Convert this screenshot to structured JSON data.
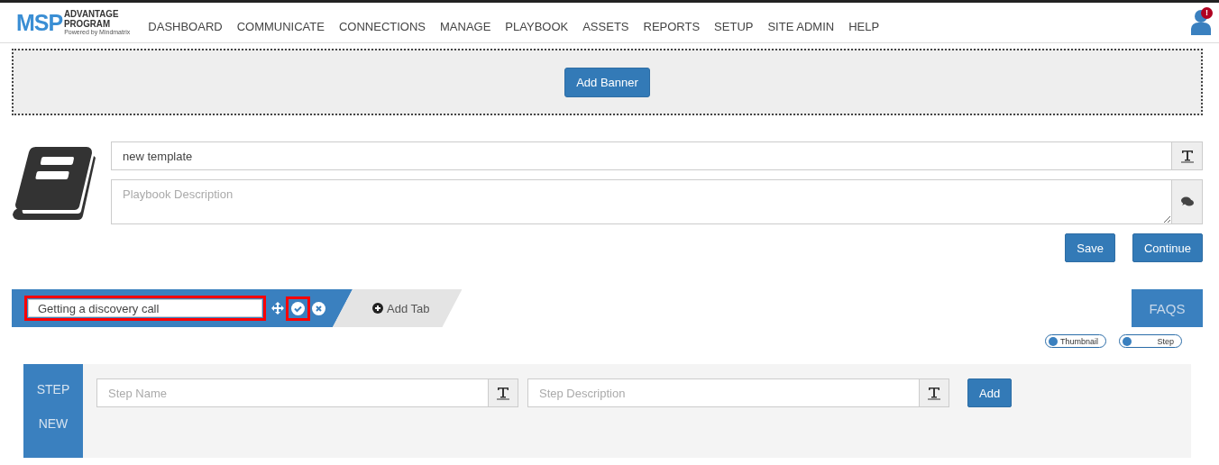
{
  "logo": {
    "main": "MSP",
    "line1": "ADVANTAGE",
    "line2": "PROGRAM",
    "tagline": "Powered by Mindmatrix"
  },
  "nav": [
    "DASHBOARD",
    "COMMUNICATE",
    "CONNECTIONS",
    "MANAGE",
    "PLAYBOOK",
    "ASSETS",
    "REPORTS",
    "SETUP",
    "SITE ADMIN",
    "HELP"
  ],
  "user": {
    "badge": "!"
  },
  "banner": {
    "button": "Add Banner"
  },
  "playbook": {
    "title_value": "new template",
    "description_placeholder": "Playbook Description",
    "buttons": [
      "Save",
      "Continue"
    ]
  },
  "tabs": [
    {
      "value": "Getting a discovery call",
      "selected": true,
      "highlighted": true,
      "confirm_highlighted": true
    }
  ],
  "add_tab": "Add Tab",
  "faqs": "FAQS",
  "toggles": [
    {
      "label": "Thumbnail",
      "on": false
    },
    {
      "label": "Step",
      "on": false
    }
  ],
  "step": {
    "labels": [
      "STEP",
      "NEW"
    ],
    "name_placeholder": "Step Name",
    "description_placeholder": "Step Description",
    "button": "Add"
  }
}
